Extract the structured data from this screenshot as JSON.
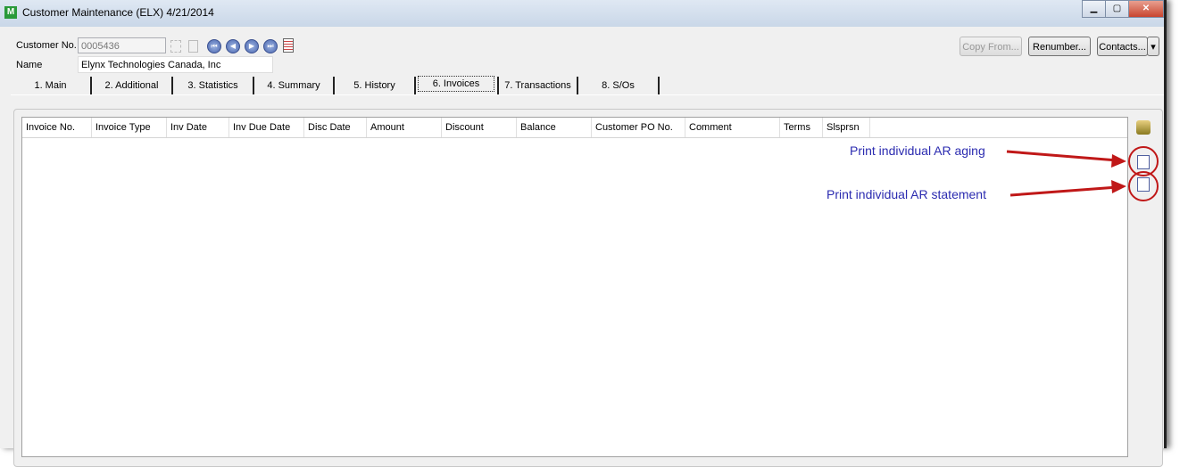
{
  "window": {
    "title": "Customer Maintenance (ELX) 4/21/2014",
    "minimize": "▁",
    "maximize": "▢",
    "close": "✕"
  },
  "header": {
    "customer_no_label": "Customer No.",
    "customer_no": "0005436",
    "name_label": "Name",
    "name": "Elynx Technologies Canada, Inc",
    "nav": [
      "⏮",
      "◀",
      "▶",
      "⏭"
    ],
    "buttons": {
      "copy_from": "Copy From...",
      "renumber": "Renumber...",
      "contacts": "Contacts...",
      "contacts_dropdown": "▾"
    }
  },
  "tabs": [
    "1. Main",
    "2. Additional",
    "3. Statistics",
    "4. Summary",
    "5. History",
    "6. Invoices",
    "7. Transactions",
    "8. S/Os"
  ],
  "selected_tab": "6. Invoices",
  "grid": {
    "columns": [
      "Invoice No.",
      "Invoice Type",
      "Inv Date",
      "Inv Due Date",
      "Disc Date",
      "Amount",
      "Discount",
      "Balance",
      "Customer PO No.",
      "Comment",
      "Terms",
      "Slsprsn"
    ],
    "rows": []
  },
  "annotations": {
    "aging": "Print individual AR aging",
    "statement": "Print individual AR statement"
  },
  "colors": {
    "annotation_text": "#2b2bb0",
    "arrow": "#c01818"
  }
}
